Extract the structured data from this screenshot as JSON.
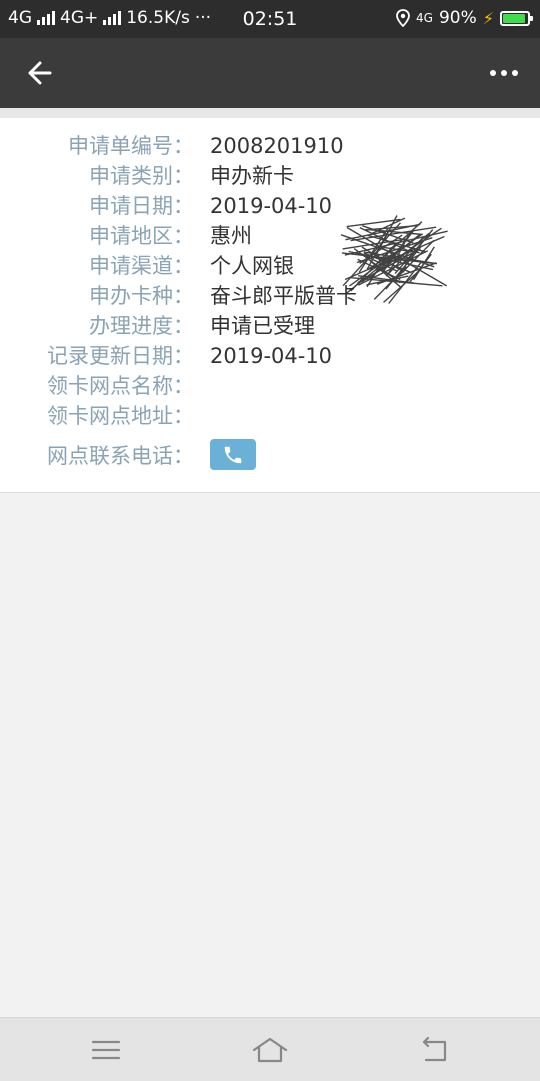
{
  "status_bar": {
    "net1": "4G",
    "net2": "4G+",
    "speed": "16.5K/s",
    "dots": "···",
    "time": "02:51",
    "net_right": "4G",
    "battery_pct": "90%",
    "battery_level": 0.9,
    "battery_color": "#3fdc4c"
  },
  "app_bar": {
    "back_icon": "arrow-left-icon",
    "more_icon": "more-dots-icon"
  },
  "details": {
    "rows": [
      {
        "label": "申请单编号：",
        "value": "2008201910"
      },
      {
        "label": "申请类别：",
        "value": "申办新卡"
      },
      {
        "label": "申请日期：",
        "value": "2019-04-10"
      },
      {
        "label": "申请地区：",
        "value": "惠州"
      },
      {
        "label": "申请渠道：",
        "value": "个人网银"
      },
      {
        "label": "申办卡种：",
        "value": "奋斗郎平版普卡"
      },
      {
        "label": "办理进度：",
        "value": "申请已受理"
      },
      {
        "label": "记录更新日期：",
        "value": "2019-04-10"
      },
      {
        "label": "领卡网点名称：",
        "value": ""
      },
      {
        "label": "领卡网点地址：",
        "value": ""
      },
      {
        "label": "网点联系电话：",
        "value": ""
      }
    ],
    "phone_icon": "phone-icon",
    "label_color": "#8aa3b5",
    "accent_color": "#6bb0d6"
  },
  "nav_bar": {
    "menu_icon": "menu-icon",
    "home_icon": "home-icon",
    "back_icon": "back-return-icon"
  }
}
